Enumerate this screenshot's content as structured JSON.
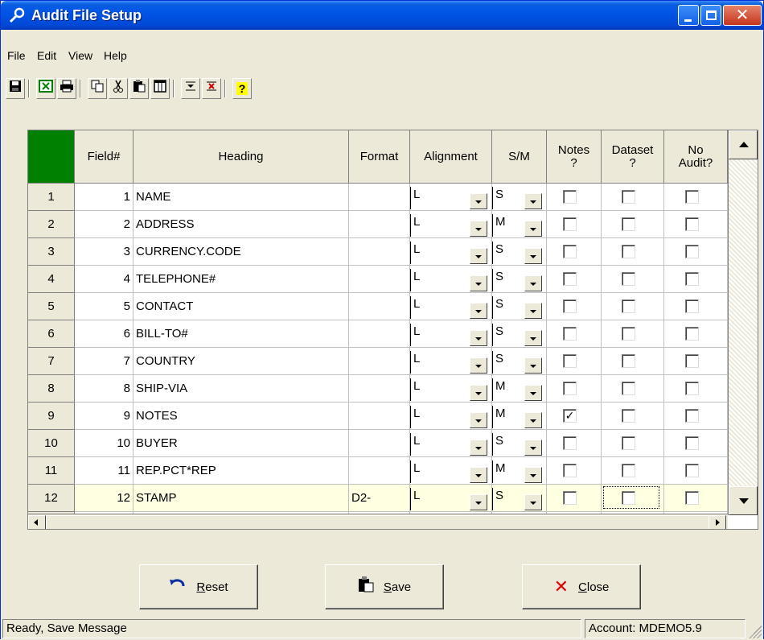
{
  "window": {
    "title": "Audit File Setup"
  },
  "menu": [
    "File",
    "Edit",
    "View",
    "Help"
  ],
  "toolbar_icons": [
    "save-icon",
    "excel-icon",
    "print-icon",
    "copy-icon",
    "cut-icon",
    "paste-icon",
    "columns-icon",
    "insert-row-icon",
    "delete-row-icon",
    "help-icon"
  ],
  "grid": {
    "headers": {
      "field": "Field#",
      "heading": "Heading",
      "format": "Format",
      "alignment": "Alignment",
      "sm": "S/M",
      "notes": [
        "Notes",
        "?"
      ],
      "dataset": [
        "Dataset",
        "?"
      ],
      "noaudit": [
        "No",
        "Audit?"
      ]
    },
    "rows": [
      {
        "row": "1",
        "field": "1",
        "heading": "NAME",
        "format": "",
        "alignment": "L",
        "sm": "S",
        "notes": false,
        "dataset": false,
        "noaudit": false
      },
      {
        "row": "2",
        "field": "2",
        "heading": "ADDRESS",
        "format": "",
        "alignment": "L",
        "sm": "M",
        "notes": false,
        "dataset": false,
        "noaudit": false
      },
      {
        "row": "3",
        "field": "3",
        "heading": "CURRENCY.CODE",
        "format": "",
        "alignment": "L",
        "sm": "S",
        "notes": false,
        "dataset": false,
        "noaudit": false
      },
      {
        "row": "4",
        "field": "4",
        "heading": "TELEPHONE#",
        "format": "",
        "alignment": "L",
        "sm": "S",
        "notes": false,
        "dataset": false,
        "noaudit": false
      },
      {
        "row": "5",
        "field": "5",
        "heading": "CONTACT",
        "format": "",
        "alignment": "L",
        "sm": "S",
        "notes": false,
        "dataset": false,
        "noaudit": false
      },
      {
        "row": "6",
        "field": "6",
        "heading": "BILL-TO#",
        "format": "",
        "alignment": "L",
        "sm": "S",
        "notes": false,
        "dataset": false,
        "noaudit": false
      },
      {
        "row": "7",
        "field": "7",
        "heading": "COUNTRY",
        "format": "",
        "alignment": "L",
        "sm": "S",
        "notes": false,
        "dataset": false,
        "noaudit": false
      },
      {
        "row": "8",
        "field": "8",
        "heading": "SHIP-VIA",
        "format": "",
        "alignment": "L",
        "sm": "M",
        "notes": false,
        "dataset": false,
        "noaudit": false
      },
      {
        "row": "9",
        "field": "9",
        "heading": "NOTES",
        "format": "",
        "alignment": "L",
        "sm": "M",
        "notes": true,
        "dataset": false,
        "noaudit": false
      },
      {
        "row": "10",
        "field": "10",
        "heading": "BUYER",
        "format": "",
        "alignment": "L",
        "sm": "S",
        "notes": false,
        "dataset": false,
        "noaudit": false
      },
      {
        "row": "11",
        "field": "11",
        "heading": "REP.PCT*REP",
        "format": "",
        "alignment": "L",
        "sm": "M",
        "notes": false,
        "dataset": false,
        "noaudit": false
      },
      {
        "row": "12",
        "field": "12",
        "heading": "STAMP",
        "format": "D2-",
        "alignment": "L",
        "sm": "S",
        "notes": false,
        "dataset": false,
        "noaudit": false
      }
    ],
    "selected_row": "12"
  },
  "buttons": {
    "reset": "Reset",
    "save": "Save",
    "close": "Close"
  },
  "status": {
    "message": "Ready, Save Message",
    "account": "Account: MDEMO5.9"
  },
  "colors": {
    "corner": "#008000",
    "selected_row": "#ffffe1",
    "titlebar": "#0055e5"
  }
}
